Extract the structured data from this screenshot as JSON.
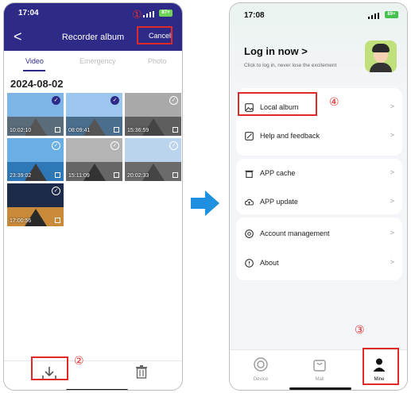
{
  "left_screen": {
    "status_time": "17:04",
    "battery": "87+",
    "header": {
      "back_glyph": "<",
      "title": "Recorder album",
      "cancel_label": "Cancel"
    },
    "tabs": [
      "Video",
      "Emergency",
      "Photo"
    ],
    "active_tab": "Video",
    "date_heading": "2024-08-02",
    "thumbnails": [
      {
        "duration": "10:02:10",
        "selected": true
      },
      {
        "duration": "08:09:41",
        "selected": true
      },
      {
        "duration": "15:36:59",
        "selected": false
      },
      {
        "duration": "23:39:02",
        "selected": false
      },
      {
        "duration": "15:11:09",
        "selected": false
      },
      {
        "duration": "20:02:33",
        "selected": false
      },
      {
        "duration": "17:00:56",
        "selected": false
      }
    ]
  },
  "right_screen": {
    "status_time": "17:08",
    "battery": "89+",
    "login_title": "Log in now >",
    "login_subtitle": "Click to log in, never lose the excitement",
    "menu": {
      "local_album": "Local album",
      "help_feedback": "Help and feedback",
      "app_cache": "APP cache",
      "app_update": "APP update",
      "account_management": "Account management",
      "about": "About"
    },
    "chevron": ">",
    "tabbar": {
      "device": "Device",
      "mall": "Mall",
      "mine": "Mine"
    }
  },
  "annotations": {
    "n1": "①",
    "n2": "②",
    "n3": "③",
    "n4": "④"
  },
  "colors": {
    "header": "#2d2a88",
    "annotation": "#e02a2a",
    "arrow": "#1f8fe0"
  }
}
